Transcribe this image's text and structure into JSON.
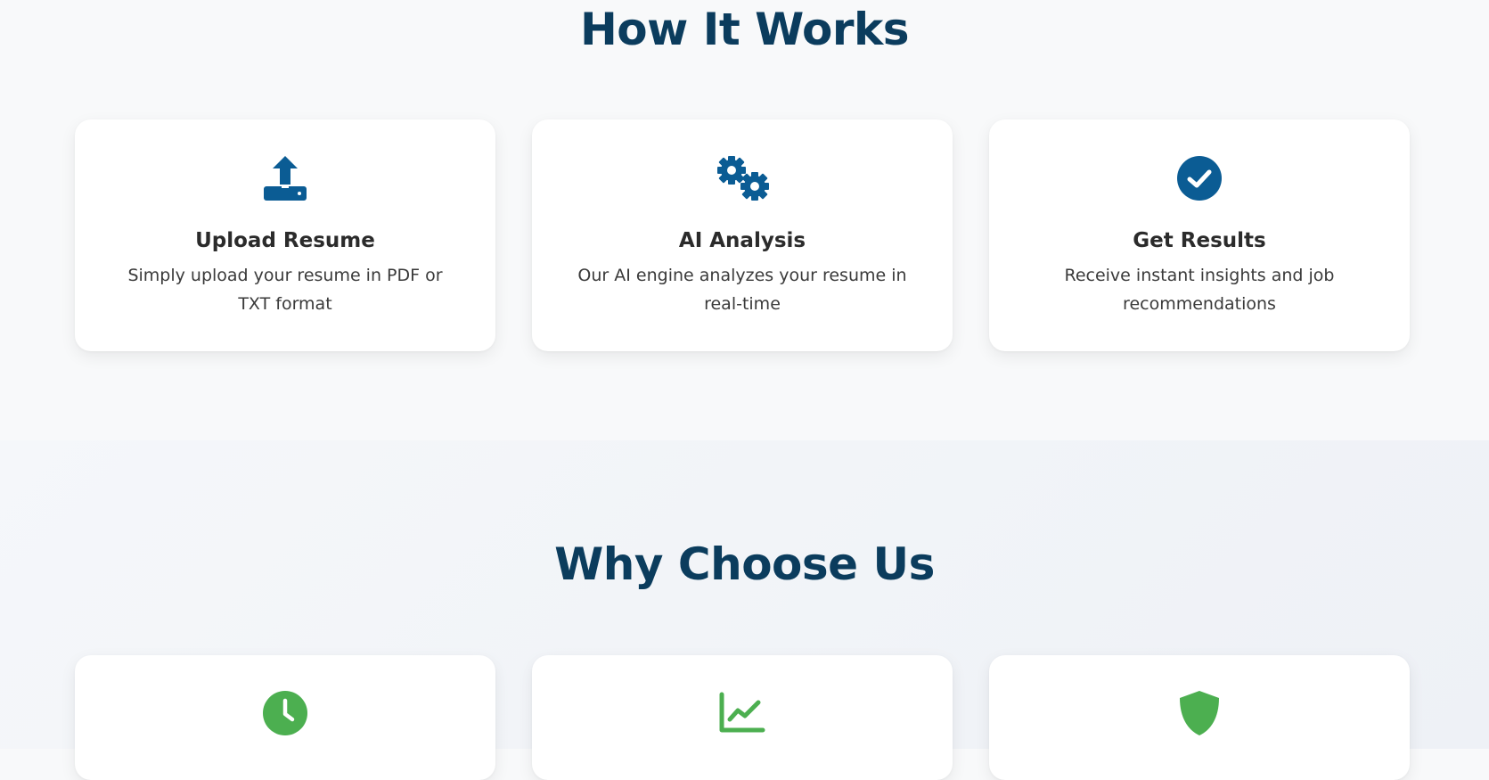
{
  "how_it_works": {
    "title": "How It Works",
    "accent_color": "#0b5c94",
    "steps": [
      {
        "icon": "upload-icon",
        "title": "Upload Resume",
        "description": "Simply upload your resume in PDF or TXT format"
      },
      {
        "icon": "gears-icon",
        "title": "AI Analysis",
        "description": "Our AI engine analyzes your resume in real-time"
      },
      {
        "icon": "check-circle-icon",
        "title": "Get Results",
        "description": "Receive instant insights and job recommendations"
      }
    ]
  },
  "why_choose_us": {
    "title": "Why Choose Us",
    "accent_color": "#4caf50",
    "features": [
      {
        "icon": "clock-icon"
      },
      {
        "icon": "chart-line-icon"
      },
      {
        "icon": "shield-icon"
      }
    ]
  }
}
